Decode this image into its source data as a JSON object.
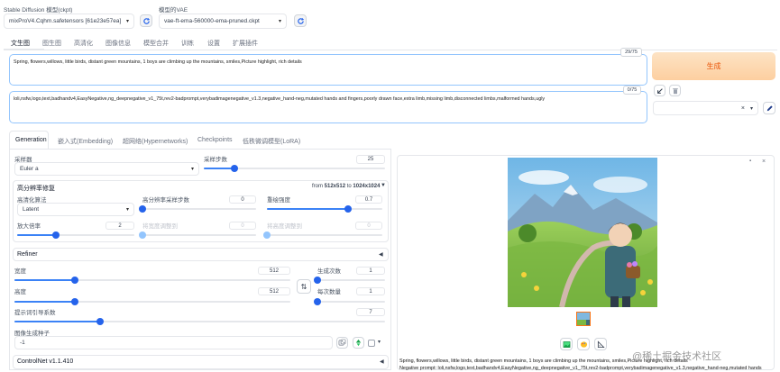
{
  "header": {
    "checkpoint_label": "Stable Diffusion 模型(ckpt)",
    "checkpoint_value": "mixProV4.Cqhm.safetensors [61e23e57ea]",
    "vae_label": "模型的VAE",
    "vae_value": "vae-ft-ema-560000-ema-pruned.ckpt"
  },
  "main_tabs": [
    "文生图",
    "图生图",
    "高清化",
    "图像信息",
    "模型合并",
    "训练",
    "设置",
    "扩展插件"
  ],
  "prompt": {
    "positive": "Spring, flowers,willows, little birds, distant green mountains, 1 boys are climbing up the mountains, smiles,Picture highlight, rich details",
    "positive_count": "29/75",
    "negative": "loli,nsfw,logo,text,badhandv4,EasyNegative,ng_deepnegative_v1_75t,rev2-badprompt,verybadimagenegative_v1.3,negative_hand-neg,mutated hands and fingers,poorly drawn face,extra limb,missing limb,disconnected limbs,malformed hands,ugly",
    "negative_count": "0/75"
  },
  "generate_label": "生成",
  "style_select": {
    "clear": "×",
    "caret": "▾"
  },
  "sub_tabs": [
    "Generation",
    "嵌入式(Embedding)",
    "超网络(Hypernetworks)",
    "Checkpoints",
    "低秩微调模型(LoRA)"
  ],
  "sampler": {
    "label": "采样器",
    "value": "Euler a",
    "steps_label": "采样步数",
    "steps_value": "25",
    "steps_ratio": 0.17
  },
  "hires": {
    "title": "高分辨率修复",
    "from_prefix": "from",
    "from_size": "512x512",
    "to_word": "to",
    "to_size": "1024x1024",
    "upscaler_label": "高清化算法",
    "upscaler_value": "Latent",
    "hires_steps_label": "高分辨率采样步数",
    "hires_steps_value": "0",
    "hires_steps_ratio": 0,
    "denoise_label": "重绘强度",
    "denoise_value": "0.7",
    "denoise_ratio": 0.7,
    "scale_label": "放大倍率",
    "scale_value": "2",
    "scale_ratio": 0.33,
    "resize_w_label": "将宽度调整到",
    "resize_w_value": "0",
    "resize_h_label": "将高度调整到",
    "resize_h_value": "0"
  },
  "refiner": {
    "title": "Refiner",
    "arrow": "◀"
  },
  "dims": {
    "width_label": "宽度",
    "width_value": "512",
    "width_ratio": 0.22,
    "height_label": "高度",
    "height_value": "512",
    "height_ratio": 0.22,
    "batch_count_label": "生成次数",
    "batch_count_value": "1",
    "batch_count_ratio": 0,
    "batch_size_label": "每次数量",
    "batch_size_value": "1",
    "batch_size_ratio": 0,
    "swap_glyph": "⇅"
  },
  "cfg": {
    "label": "提示词引导系数",
    "value": "7",
    "ratio": 0.23
  },
  "seed": {
    "label": "图像生成种子",
    "value": "-1"
  },
  "controlnet": {
    "title": "ControlNet v1.1.410",
    "arrow": "◀"
  },
  "output": {
    "caption_line1": "Spring, flowers,willows, little birds, distant green mountains, 1 boys are climbing up the mountains, smiles,Picture highlight, rich details",
    "caption_line2": "Negative prompt: loli,nsfw,logo,text,badhandv4,EasyNegative,ng_deepnegative_v1_75t,rev2-badprompt,verybadimagenegative_v1.3,negative_hand-neg,mutated hands"
  },
  "watermark": "@稀土掘金技术社区",
  "colors": {
    "accent": "#3b82f6",
    "generate_bg": "#fdd5a8",
    "generate_text": "#ea580c"
  }
}
